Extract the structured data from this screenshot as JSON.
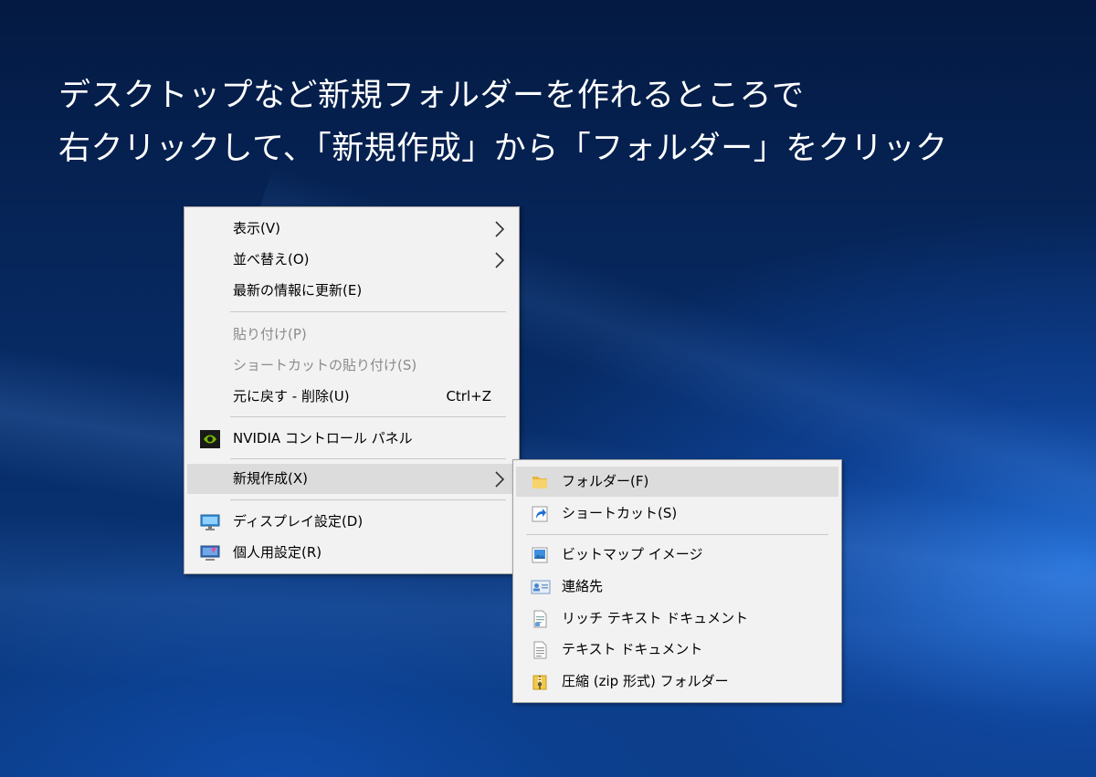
{
  "caption": {
    "line1": "デスクトップなど新規フォルダーを作れるところで",
    "line2": "右クリックして、「新規作成」から「フォルダー」をクリック"
  },
  "context_menu": {
    "view": "表示(V)",
    "sort": "並べ替え(O)",
    "refresh": "最新の情報に更新(E)",
    "paste": "貼り付け(P)",
    "paste_shortcut": "ショートカットの貼り付け(S)",
    "undo": "元に戻す - 削除(U)",
    "undo_shortcut": "Ctrl+Z",
    "nvidia": "NVIDIA コントロール パネル",
    "new": "新規作成(X)",
    "display_settings": "ディスプレイ設定(D)",
    "personalize": "個人用設定(R)"
  },
  "submenu": {
    "folder": "フォルダー(F)",
    "shortcut": "ショートカット(S)",
    "bitmap": "ビットマップ イメージ",
    "contact": "連絡先",
    "rich_text": "リッチ テキスト ドキュメント",
    "text": "テキスト ドキュメント",
    "zip": "圧縮 (zip 形式) フォルダー"
  },
  "colors": {
    "menu_bg": "#f2f2f2",
    "hover_bg": "#dcdcdc",
    "disabled_text": "#8b8b8b",
    "desktop_base": "#062a63"
  },
  "icons": {
    "nvidia": "nvidia-icon",
    "display": "display-icon",
    "personalize": "personalize-icon",
    "folder": "folder-icon",
    "shortcut": "shortcut-icon",
    "bitmap": "bitmap-icon",
    "contact": "contact-icon",
    "rich_text": "rich-text-icon",
    "text": "text-document-icon",
    "zip": "zip-folder-icon"
  }
}
